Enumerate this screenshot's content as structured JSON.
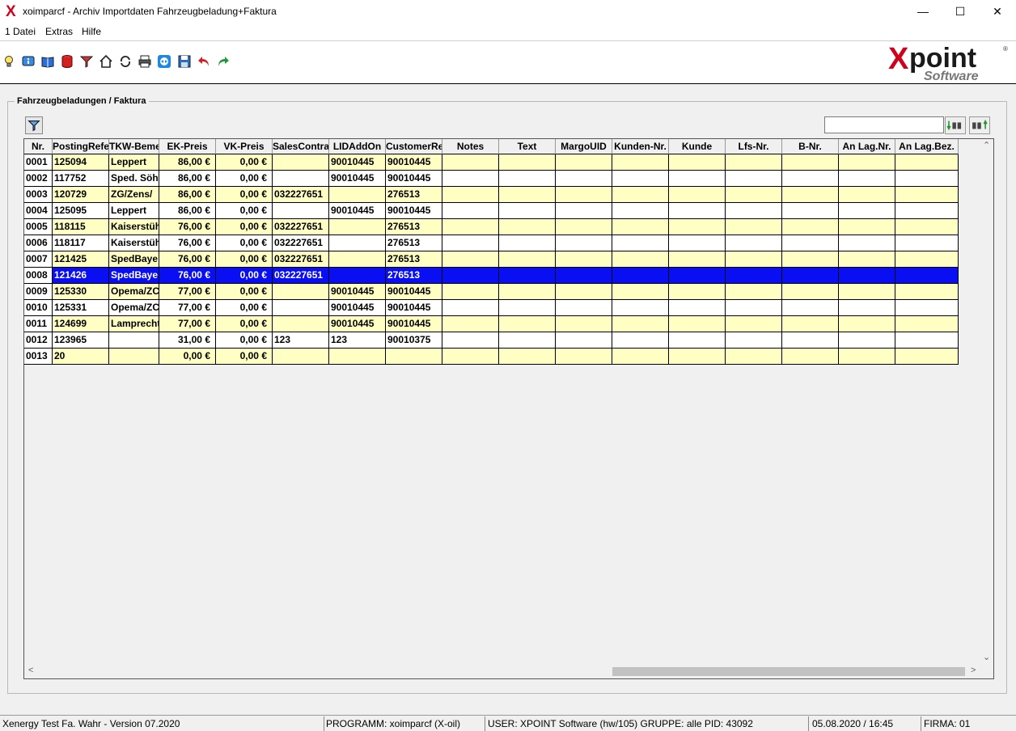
{
  "titlebar": {
    "app_icon": "X",
    "title": "xoimparcf - Archiv Importdaten Fahrzeugbeladung+Faktura",
    "minimize": "—",
    "maximize": "☐",
    "close": "✕"
  },
  "menu": [
    "1 Datei",
    "Extras",
    "Hilfe"
  ],
  "toolbar": {
    "icons": [
      "lightbulb-icon",
      "info-book-icon",
      "book-icon",
      "database-icon",
      "filter-icon",
      "home-icon",
      "refresh-icon",
      "printer-icon",
      "teamviewer-icon",
      "save-icon",
      "undo-icon",
      "redo-icon"
    ]
  },
  "logo": {
    "brand": "Xpoint",
    "sub": "Software",
    "reg": "®"
  },
  "group": {
    "title": "Fahrzeugbeladungen / Faktura"
  },
  "search": {
    "value": ""
  },
  "table": {
    "columns": [
      "Nr.",
      "PostingRefe",
      "TKW-Beme",
      "EK-Preis",
      "VK-Preis",
      "SalesContra",
      "LIDAddOn",
      "CustomerRe",
      "Notes",
      "Text",
      "MargoUID",
      "Kunden-Nr.",
      "Kunde",
      "Lfs-Nr.",
      "B-Nr.",
      "An Lag.Nr.",
      "An Lag.Bez."
    ],
    "rows": [
      [
        "0001",
        "125094",
        "Leppert",
        "86,00  €",
        "0,00  €",
        "",
        "90010445",
        "90010445",
        "",
        "",
        "",
        "",
        "",
        "",
        "",
        "",
        ""
      ],
      [
        "0002",
        "117752",
        "Sped. Söh",
        "86,00  €",
        "0,00  €",
        "",
        "90010445",
        "90010445",
        "",
        "",
        "",
        "",
        "",
        "",
        "",
        "",
        ""
      ],
      [
        "0003",
        "120729",
        "ZG/Zens/",
        "86,00  €",
        "0,00  €",
        "032227651",
        "",
        "276513",
        "",
        "",
        "",
        "",
        "",
        "",
        "",
        "",
        ""
      ],
      [
        "0004",
        "125095",
        "Leppert",
        "86,00  €",
        "0,00  €",
        "",
        "90010445",
        "90010445",
        "",
        "",
        "",
        "",
        "",
        "",
        "",
        "",
        ""
      ],
      [
        "0005",
        "118115",
        "Kaiserstüh",
        "76,00  €",
        "0,00  €",
        "032227651",
        "",
        "276513",
        "",
        "",
        "",
        "",
        "",
        "",
        "",
        "",
        ""
      ],
      [
        "0006",
        "118117",
        "Kaiserstüh",
        "76,00  €",
        "0,00  €",
        "032227651",
        "",
        "276513",
        "",
        "",
        "",
        "",
        "",
        "",
        "",
        "",
        ""
      ],
      [
        "0007",
        "121425",
        "SpedBaye",
        "76,00  €",
        "0,00  €",
        "032227651",
        "",
        "276513",
        "",
        "",
        "",
        "",
        "",
        "",
        "",
        "",
        ""
      ],
      [
        "0008",
        "121426",
        "SpedBaye",
        "76,00  €",
        "0,00  €",
        "032227651",
        "",
        "276513",
        "",
        "",
        "",
        "",
        "",
        "",
        "",
        "",
        ""
      ],
      [
        "0009",
        "125330",
        "Opema/ZC",
        "77,00  €",
        "0,00  €",
        "",
        "90010445",
        "90010445",
        "",
        "",
        "",
        "",
        "",
        "",
        "",
        "",
        ""
      ],
      [
        "0010",
        "125331",
        "Opema/ZC",
        "77,00  €",
        "0,00  €",
        "",
        "90010445",
        "90010445",
        "",
        "",
        "",
        "",
        "",
        "",
        "",
        "",
        ""
      ],
      [
        "0011",
        "124699",
        "Lamprecht",
        "77,00  €",
        "0,00  €",
        "",
        "90010445",
        "90010445",
        "",
        "",
        "",
        "",
        "",
        "",
        "",
        "",
        ""
      ],
      [
        "0012",
        "123965",
        "",
        "31,00  €",
        "0,00  €",
        "123",
        "123",
        "90010375",
        "",
        "",
        "",
        "",
        "",
        "",
        "",
        "",
        ""
      ],
      [
        "0013",
        "20",
        "",
        "0,00  €",
        "0,00  €",
        "",
        "",
        "",
        "",
        "",
        "",
        "",
        "",
        "",
        "",
        "",
        ""
      ]
    ],
    "selected_index": 7
  },
  "status": {
    "company": "Xenergy Test Fa. Wahr - Version 07.2020",
    "program": "PROGRAMM: xoimparcf (X-oil)",
    "user": "USER: XPOINT Software (hw/105)  GRUPPE: alle  PID: 43092",
    "datetime": "05.08.2020 / 16:45",
    "firma": "FIRMA: 01"
  }
}
